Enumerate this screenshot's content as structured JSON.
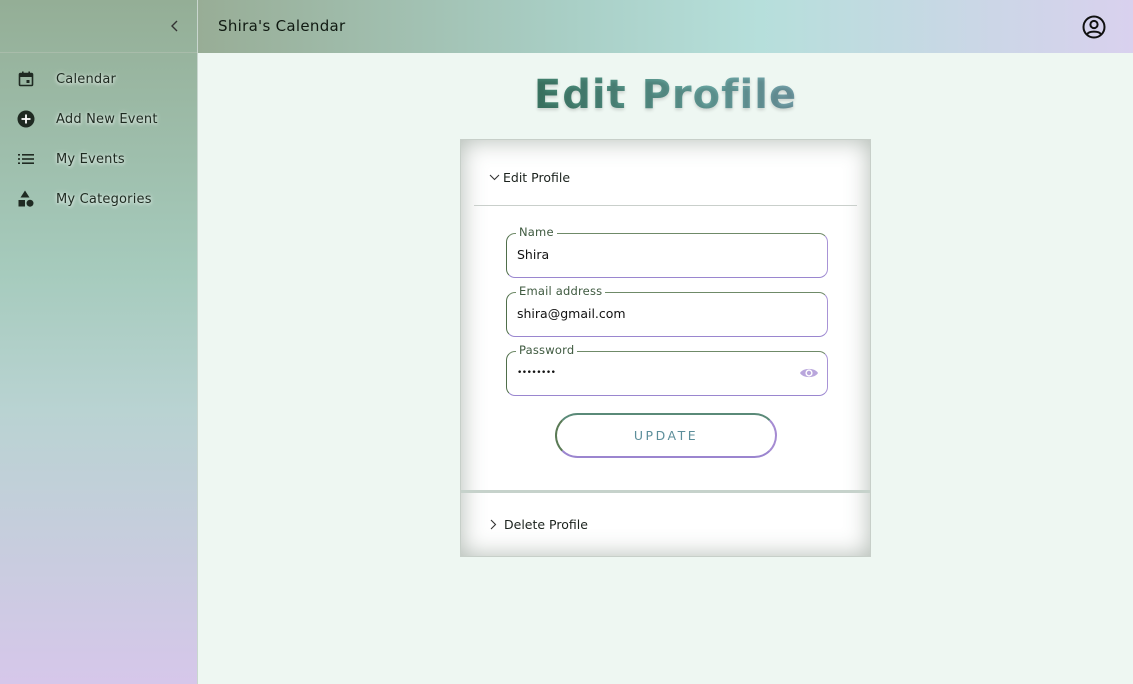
{
  "sidebar": {
    "items": [
      {
        "label": "Calendar",
        "icon": "calendar-icon"
      },
      {
        "label": "Add New Event",
        "icon": "add-circle-icon"
      },
      {
        "label": "My Events",
        "icon": "list-icon"
      },
      {
        "label": "My Categories",
        "icon": "categories-icon"
      }
    ]
  },
  "header": {
    "title": "Shira's Calendar"
  },
  "page": {
    "title": "Edit Profile"
  },
  "edit_section": {
    "heading": "Edit Profile",
    "fields": {
      "name": {
        "label": "Name",
        "value": "Shira"
      },
      "email": {
        "label": "Email address",
        "value": "shira@gmail.com"
      },
      "password": {
        "label": "Password",
        "value": "••••••••"
      }
    },
    "update_label": "UPDATE"
  },
  "delete_section": {
    "heading": "Delete Profile"
  },
  "colors": {
    "accent_green": "#4e6a48",
    "accent_teal": "#6aa7a3",
    "accent_purple": "#9b84c6",
    "page_bg": "#eef7f2"
  }
}
